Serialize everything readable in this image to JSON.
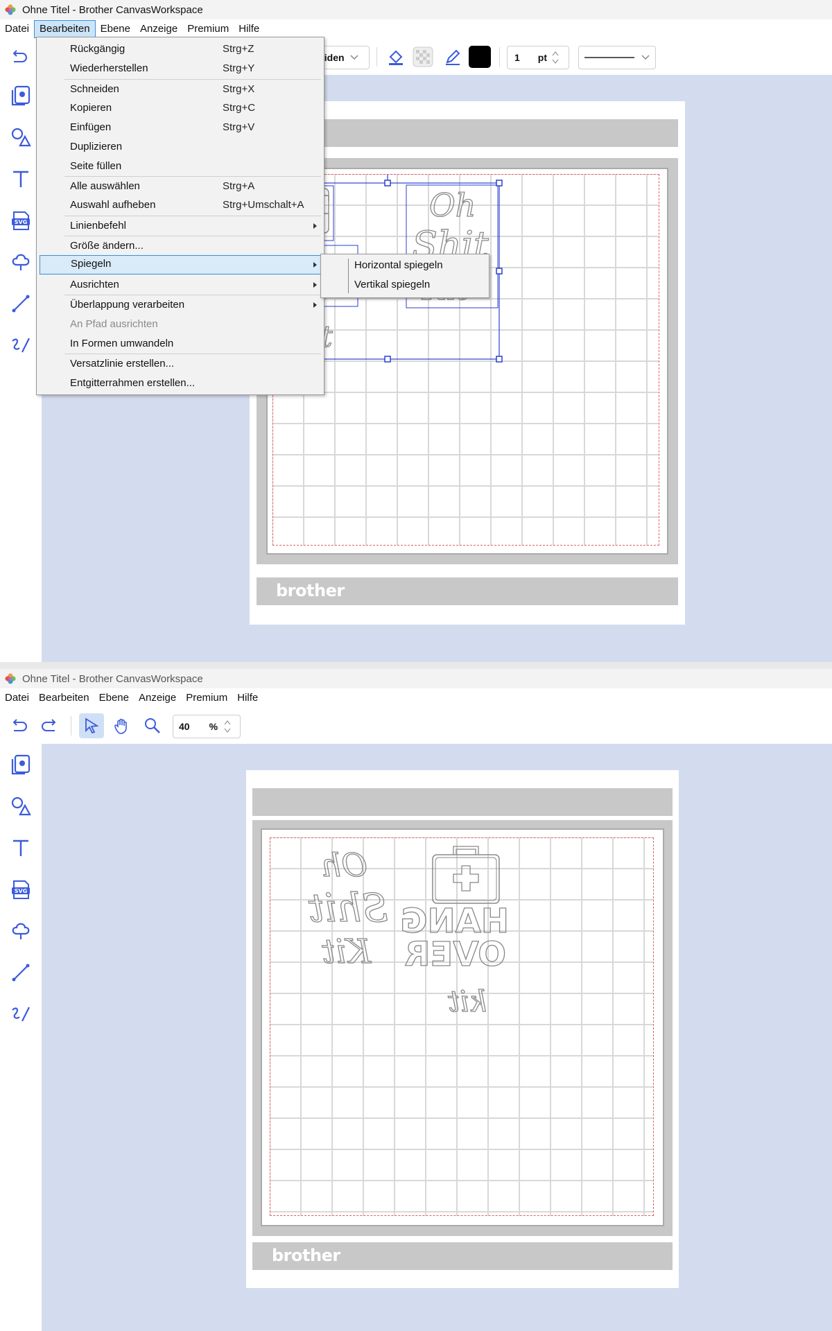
{
  "window_title": "Ohne Titel - Brother CanvasWorkspace",
  "menu": [
    "Datei",
    "Bearbeiten",
    "Ebene",
    "Anzeige",
    "Premium",
    "Hilfe"
  ],
  "toolbar_top": {
    "line_style_partial": "eiden",
    "stroke_width": "1",
    "stroke_unit": "pt",
    "fill_color": "#000000"
  },
  "toolbar_bottom": {
    "zoom_value": "40",
    "zoom_unit": "%"
  },
  "edit_menu": [
    {
      "label": "Rückgängig",
      "shortcut": "Strg+Z"
    },
    {
      "label": "Wiederherstellen",
      "shortcut": "Strg+Y"
    },
    {
      "label": "Schneiden",
      "shortcut": "Strg+X"
    },
    {
      "label": "Kopieren",
      "shortcut": "Strg+C"
    },
    {
      "label": "Einfügen",
      "shortcut": "Strg+V"
    },
    {
      "label": "Duplizieren",
      "shortcut": ""
    },
    {
      "label": "Seite füllen",
      "shortcut": ""
    },
    {
      "label": "Alle auswählen",
      "shortcut": "Strg+A"
    },
    {
      "label": "Auswahl aufheben",
      "shortcut": "Strg+Umschalt+A"
    },
    {
      "label": "Linienbefehl",
      "shortcut": ""
    },
    {
      "label": "Größe ändern...",
      "shortcut": ""
    },
    {
      "label": "Spiegeln",
      "shortcut": ""
    },
    {
      "label": "Ausrichten",
      "shortcut": ""
    },
    {
      "label": "Überlappung verarbeiten",
      "shortcut": ""
    },
    {
      "label": "An Pfad ausrichten",
      "shortcut": ""
    },
    {
      "label": "In Formen umwandeln",
      "shortcut": ""
    },
    {
      "label": "Versatzlinie erstellen...",
      "shortcut": ""
    },
    {
      "label": "Entgitterrahmen erstellen...",
      "shortcut": ""
    }
  ],
  "mirror_submenu": [
    "Horizontal spiegeln",
    "Vertikal spiegeln"
  ],
  "brand": "brother",
  "artwork": {
    "script_lines": [
      "Oh",
      "Shit",
      "Kit"
    ],
    "block_lines": [
      "HANG",
      "OVER"
    ],
    "small_script": "kit"
  },
  "colors": {
    "accent": "#3b5bdb",
    "workarea": "#d3dcef",
    "selection": "#2a3fd1"
  }
}
